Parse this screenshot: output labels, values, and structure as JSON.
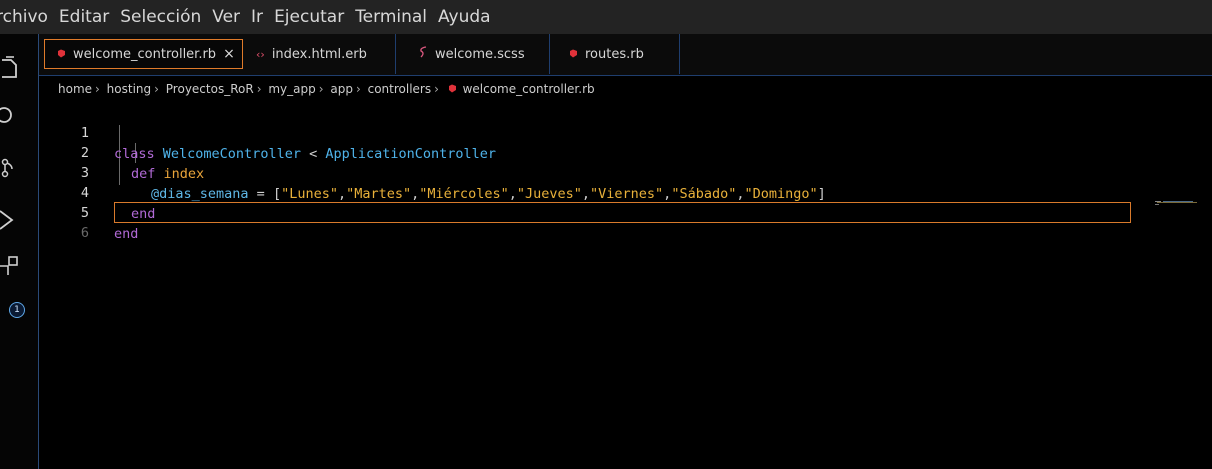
{
  "menubar": [
    "rchivo",
    "Editar",
    "Selección",
    "Ver",
    "Ir",
    "Ejecutar",
    "Terminal",
    "Ayuda"
  ],
  "activity": {
    "badge_count": "1"
  },
  "tabs": [
    {
      "label": "welcome_controller.rb",
      "icon": "ruby-icon",
      "close": "×",
      "active": true
    },
    {
      "label": "index.html.erb",
      "icon": "html-icon",
      "active": false
    },
    {
      "label": "welcome.scss",
      "icon": "sass-icon",
      "active": false
    },
    {
      "label": "routes.rb",
      "icon": "ruby-icon",
      "active": false
    }
  ],
  "breadcrumb": [
    "home",
    "hosting",
    "Proyectos_RoR",
    "my_app",
    "app",
    "controllers",
    "welcome_controller.rb"
  ],
  "code": {
    "line_numbers": [
      "1",
      "2",
      "3",
      "4",
      "5",
      "6"
    ],
    "l1": {
      "kw": "class",
      "name": "WelcomeController",
      "op": " < ",
      "parent": "ApplicationController"
    },
    "l2": {
      "kw": "def",
      "name": "index"
    },
    "l3": {
      "ivar": "@dias_semana",
      "assign": " = ",
      "open": "[",
      "items": [
        "\"Lunes\"",
        "\"Martes\"",
        "\"Miércoles\"",
        "\"Jueves\"",
        "\"Viernes\"",
        "\"Sábado\"",
        "\"Domingo\""
      ],
      "close": "]"
    },
    "l4": {
      "kw": "end"
    },
    "l5": {
      "kw": "end"
    }
  },
  "colors": {
    "accent_border": "#e07b2a",
    "ruby": "#e0323a",
    "keyword": "#b16ad6",
    "class": "#4fb3ea",
    "string": "#e9b13a"
  }
}
